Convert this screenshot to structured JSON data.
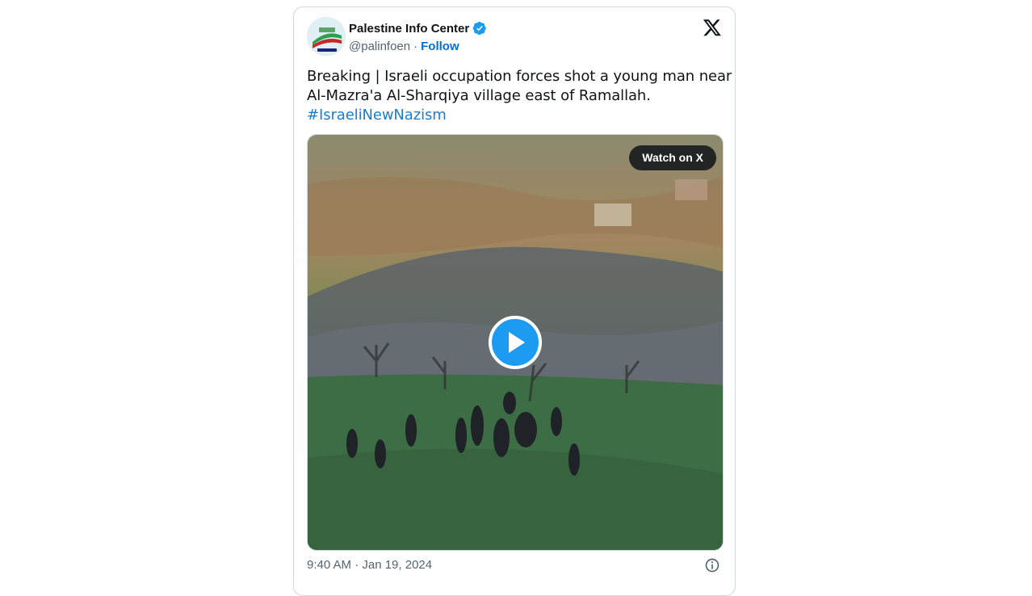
{
  "tweet": {
    "author": {
      "name": "Palestine Info Center",
      "handle": "@palinfoen",
      "separator": "·",
      "follow_label": "Follow",
      "verified": true
    },
    "text_lines": [
      "Breaking | Israeli occupation forces shot a young man near",
      "Al-Mazra'a Al-Sharqiya village east of Ramallah."
    ],
    "hashtag": "#IsraeliNewNazism",
    "media": {
      "type": "video",
      "watch_label": "Watch on X"
    },
    "timestamp": "9:40 AM · Jan 19, 2024"
  },
  "icons": {
    "brand": "x-logo-icon",
    "verified": "verified-badge-icon",
    "play": "play-icon",
    "info": "info-icon"
  },
  "colors": {
    "link": "#006fd6",
    "hashtag": "#1d7bd0",
    "play_button": "#1d9bf0",
    "text": "#0f1419",
    "muted": "#536471"
  }
}
